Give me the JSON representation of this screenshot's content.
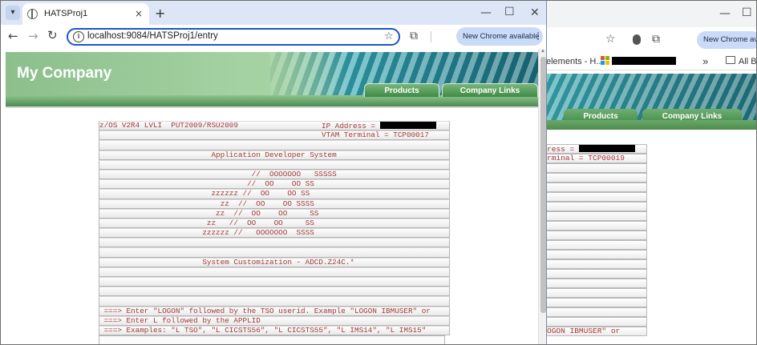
{
  "front": {
    "tab": {
      "title": "HATSProj1",
      "close_glyph": "×"
    },
    "new_tab_glyph": "+",
    "window_controls": {
      "minimize": "—",
      "maximize": "☐",
      "close": "✕"
    },
    "nav": {
      "back": "←",
      "forward": "→",
      "reload": "↻"
    },
    "address": {
      "info_glyph": "i",
      "url": "localhost:9084/HATSProj1/entry",
      "star": "☆"
    },
    "extensions_glyph": "⧉",
    "new_chrome_label": "New Chrome available",
    "menu_glyph": "⋮",
    "page": {
      "company_name": "My Company",
      "nav_products": "Products",
      "nav_company_links": "Company Links",
      "terminal": {
        "rows": [
          {
            "left": "z/OS V2R4 LVLI  PUT2009/RSU2009",
            "right": "IP Address = ",
            "redacted": true
          },
          {
            "left": "",
            "right": "VTAM Terminal = TCP00017",
            "redacted": false
          },
          {
            "left": "",
            "right": "",
            "redacted": false
          },
          {
            "left": "                         Application Developer System",
            "right": "",
            "redacted": false
          },
          {
            "left": "",
            "right": "",
            "redacted": false
          },
          {
            "left": "                                  //  OOOOOOO   SSSSS",
            "right": "",
            "redacted": false
          },
          {
            "left": "                                 //  OO    OO SS",
            "right": "",
            "redacted": false
          },
          {
            "left": "                         zzzzzz //  OO    OO SS",
            "right": "",
            "redacted": false
          },
          {
            "left": "                           zz  //  OO    OO SSSS",
            "right": "",
            "redacted": false
          },
          {
            "left": "                          zz  //  OO    OO     SS",
            "right": "",
            "redacted": false
          },
          {
            "left": "                        zz   //  OO    OO     SS",
            "right": "",
            "redacted": false
          },
          {
            "left": "                       zzzzzz //   OOOOOOO  SSSS",
            "right": "",
            "redacted": false
          },
          {
            "left": "",
            "right": "",
            "redacted": false
          },
          {
            "left": "",
            "right": "",
            "redacted": false
          },
          {
            "left": "                       System Customization - ADCD.Z24C.*",
            "right": "",
            "redacted": false
          },
          {
            "left": "",
            "right": "",
            "redacted": false
          },
          {
            "left": "",
            "right": "",
            "redacted": false
          },
          {
            "left": "",
            "right": "",
            "redacted": false
          },
          {
            "left": "",
            "right": "",
            "redacted": false
          },
          {
            "left": " ===> Enter \"LOGON\" followed by the TSO userid. Example \"LOGON IBMUSER\" or",
            "right": "",
            "redacted": false
          },
          {
            "left": " ===> Enter L followed by the APPLID",
            "right": "",
            "redacted": false
          },
          {
            "left": " ===> Examples: \"L TSO\", \"L CICSTS56\", \"L CICSTS55\", \"L IMS14\", \"L IMS15\"",
            "right": "",
            "redacted": false
          }
        ]
      }
    }
  },
  "back": {
    "window_controls": {
      "minimize": "—",
      "maximize": "☐"
    },
    "toolbar": {
      "star": "☆",
      "extensions_glyph": "⧉",
      "new_chrome_label": "New Chrome available"
    },
    "bookmarks": {
      "elements_label": "elements - H...",
      "more": "»",
      "all_bookmarks": "All Bo"
    },
    "page": {
      "nav_products": "Products",
      "nav_company_links": "Company Links",
      "rows": [
        "ress = ",
        "rminal = TCP00019",
        "",
        "",
        "",
        "",
        "",
        "",
        "",
        "",
        "",
        "",
        "",
        "",
        "",
        "",
        "",
        "",
        "",
        "OGON IBMUSER\" or"
      ]
    }
  }
}
